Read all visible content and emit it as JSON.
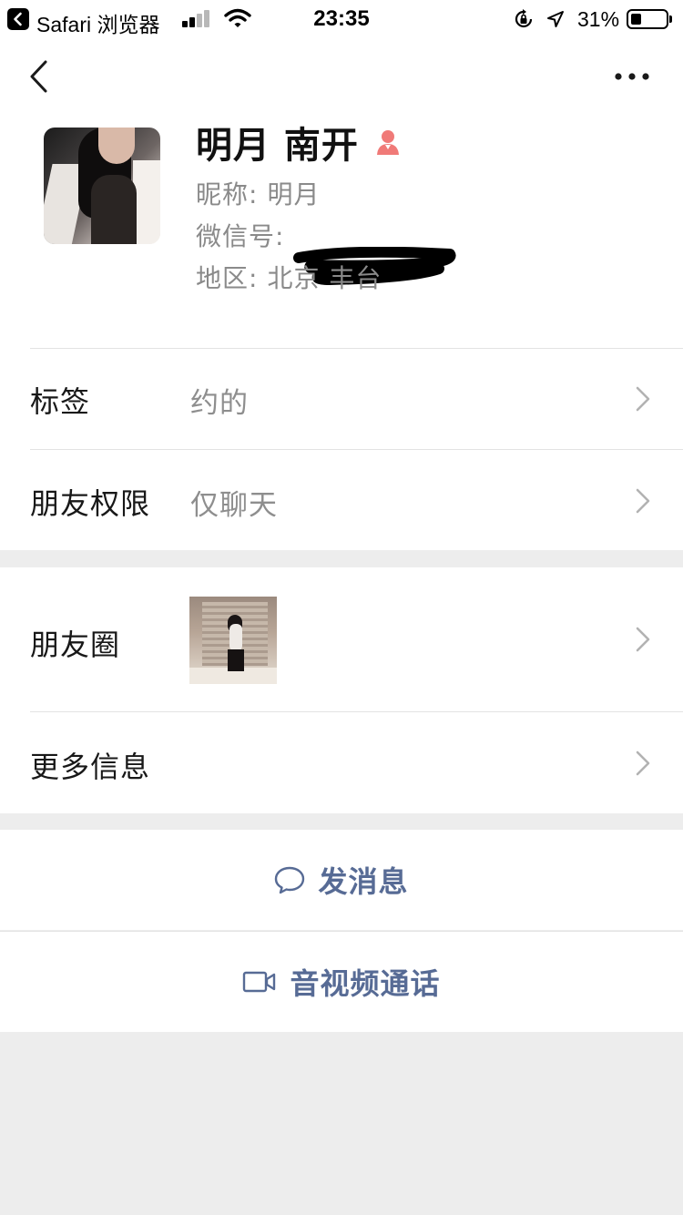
{
  "status_bar": {
    "back_app": "Safari 浏览器",
    "time": "23:35",
    "battery_percent": "31%",
    "battery_level": 0.31,
    "signal_bars": 2,
    "icons": [
      "back-app-icon",
      "signal-icon",
      "wifi-icon",
      "rotation-lock-icon",
      "location-icon",
      "battery-icon"
    ]
  },
  "nav": {
    "back_icon": "chevron-left-icon",
    "more_icon": "more-dots-icon"
  },
  "profile": {
    "name": "明月 南开",
    "gender_icon": "female-icon",
    "gender_color": "#fa5151",
    "nickname_label": "昵称:",
    "nickname": "明月",
    "wechat_id_label": "微信号:",
    "region_label": "地区:",
    "region": "北京 丰台"
  },
  "rows": {
    "tags": {
      "label": "标签",
      "value": "约的"
    },
    "permissions": {
      "label": "朋友权限",
      "value": "仅聊天"
    },
    "moments": {
      "label": "朋友圈"
    },
    "more_info": {
      "label": "更多信息"
    }
  },
  "actions": {
    "message": {
      "label": "发消息",
      "icon": "chat-bubble-icon"
    },
    "video_call": {
      "label": "音视频通话",
      "icon": "video-camera-icon"
    }
  },
  "colors": {
    "link_blue": "#576b95",
    "background": "#ededed",
    "secondary_text": "#8a8a8a"
  }
}
